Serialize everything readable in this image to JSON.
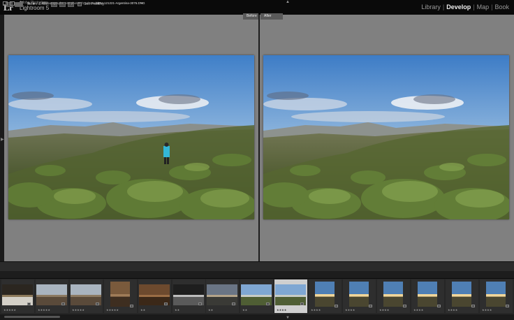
{
  "app": {
    "logo_mark": "Lr",
    "logo_subtitle": "Adobe Photoshop",
    "logo_name": "Lightroom 5"
  },
  "modules": [
    {
      "label": "Library",
      "active": false
    },
    {
      "label": "Develop",
      "active": true
    },
    {
      "label": "Map",
      "active": false
    },
    {
      "label": "Book",
      "active": false
    }
  ],
  "compare": {
    "before_label": "Before",
    "after_label": "After"
  },
  "toolbar": {
    "view_mode_label": "Before & After :",
    "soft_proofing_label": "Soft Proofing"
  },
  "filmstrip_header": {
    "source": "All Photographs",
    "count": "160 photos /1 selected /",
    "filename": "NPH-121221-Argentina-3076.DNG",
    "dropdown_icon": "chevron-down-icon"
  },
  "filmstrip": {
    "thumbnails": [
      {
        "kind": "dark",
        "rating": "★★★★★",
        "selected": false
      },
      {
        "kind": "town",
        "rating": "★★★★★",
        "selected": false
      },
      {
        "kind": "town",
        "rating": "★★★★★",
        "selected": false
      },
      {
        "kind": "portrait-brown",
        "rating": "★★★★★",
        "selected": false
      },
      {
        "kind": "brown",
        "rating": "★★",
        "selected": false
      },
      {
        "kind": "bw",
        "rating": "★★",
        "selected": false
      },
      {
        "kind": "dusk",
        "rating": "★★",
        "selected": false
      },
      {
        "kind": "landscape",
        "rating": "★★",
        "selected": false
      },
      {
        "kind": "landscape",
        "rating": "★★★★",
        "selected": true
      },
      {
        "kind": "sunset",
        "rating": "★★★★",
        "selected": false
      },
      {
        "kind": "sunset",
        "rating": "★★★★",
        "selected": false
      },
      {
        "kind": "sunset",
        "rating": "★★★★",
        "selected": false
      },
      {
        "kind": "sunset",
        "rating": "★★★★",
        "selected": false
      },
      {
        "kind": "sunset",
        "rating": "★★★★",
        "selected": false
      },
      {
        "kind": "sunset",
        "rating": "★★★★",
        "selected": false
      }
    ]
  },
  "colors": {
    "viewer_bg": "#808080",
    "selected_cell": "#cfcfcf",
    "active_module": "#f0f0f0"
  }
}
